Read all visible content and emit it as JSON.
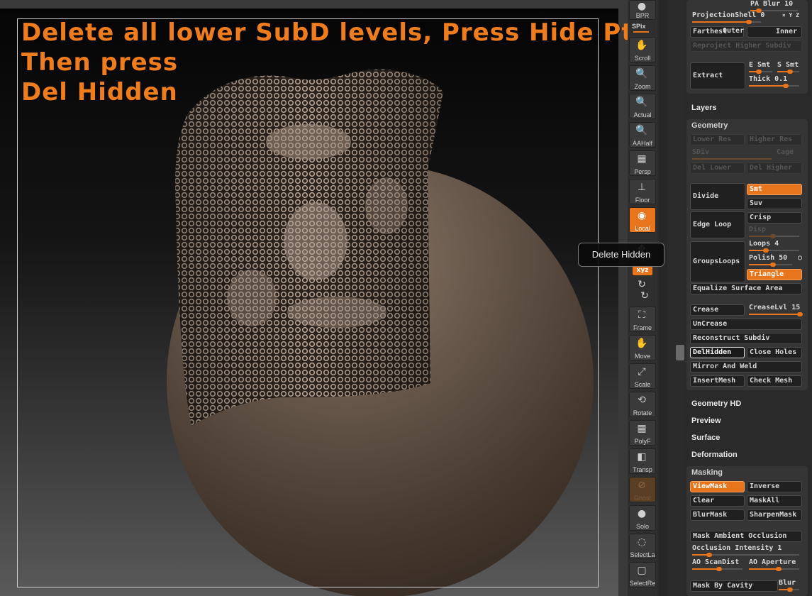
{
  "annotation": {
    "line1": "Delete all lower SubD levels, Press Hide Pt",
    "line2": "Then press",
    "line3": "Del Hidden"
  },
  "tooltip": "Delete Hidden",
  "toolbar": {
    "bpr": "BPR",
    "spix": "SPix",
    "scroll": "Scroll",
    "zoom": "Zoom",
    "actual": "Actual",
    "aahalf": "AAHalf",
    "persp": "Persp",
    "floor": "Floor",
    "local": "Local",
    "xyz": "xyz",
    "frame": "Frame",
    "move": "Move",
    "scale": "Scale",
    "rotate": "Rotate",
    "polyf": "PolyF",
    "transp": "Transp",
    "ghost": "Ghost",
    "solo": "Solo",
    "selectla": "SelectLa",
    "selectre": "SelectRe"
  },
  "panel": {
    "top": {
      "pa_blur": "PA Blur 10",
      "projection_shell": "ProjectionShell 0",
      "xyz": "× Y Z",
      "farthest": "Farthest",
      "outer": "Outer",
      "inner": "Inner",
      "reproject": "Reproject Higher Subdiv",
      "extract": "Extract",
      "e_smt": "E Smt",
      "s_smt": "S Smt",
      "thick": "Thick 0.1"
    },
    "layers": "Layers",
    "geometry": {
      "title": "Geometry",
      "lower_res": "Lower Res",
      "higher_res": "Higher Res",
      "sdiv": "SDiv",
      "cage": "Cage",
      "del_lower": "Del Lower",
      "del_higher": "Del Higher",
      "divide": "Divide",
      "smt": "Smt",
      "suv": "Suv",
      "edge_loop": "Edge Loop",
      "crisp": "Crisp",
      "disp": "Disp",
      "groups_loops": "GroupsLoops",
      "loops": "Loops 4",
      "polish": "Polish 50",
      "triangle": "Triangle",
      "equalize": "Equalize Surface Area",
      "crease": "Crease",
      "crease_lvl": "CreaseLvl 15",
      "uncrease": "UnCrease",
      "reconstruct": "Reconstruct Subdiv",
      "del_hidden": "DelHidden",
      "close_holes": "Close Holes",
      "mirror_weld": "Mirror And Weld",
      "insert_mesh": "InsertMesh",
      "check_mesh": "Check Mesh"
    },
    "geometry_hd": "Geometry HD",
    "preview": "Preview",
    "surface": "Surface",
    "deformation": "Deformation",
    "masking": {
      "title": "Masking",
      "viewmask": "ViewMask",
      "inverse": "Inverse",
      "clear": "Clear",
      "maskall": "MaskAll",
      "blurmask": "BlurMask",
      "sharpenmask": "SharpenMask",
      "mask_ao": "Mask Ambient Occlusion",
      "occlusion_intensity": "Occlusion Intensity 1",
      "ao_scandist": "AO ScanDist",
      "ao_aperture": "AO Aperture",
      "mask_by_cavity": "Mask By Cavity",
      "blur": "Blur"
    }
  },
  "colors": {
    "accent": "#e8741c",
    "annotation": "#f07d1d"
  }
}
